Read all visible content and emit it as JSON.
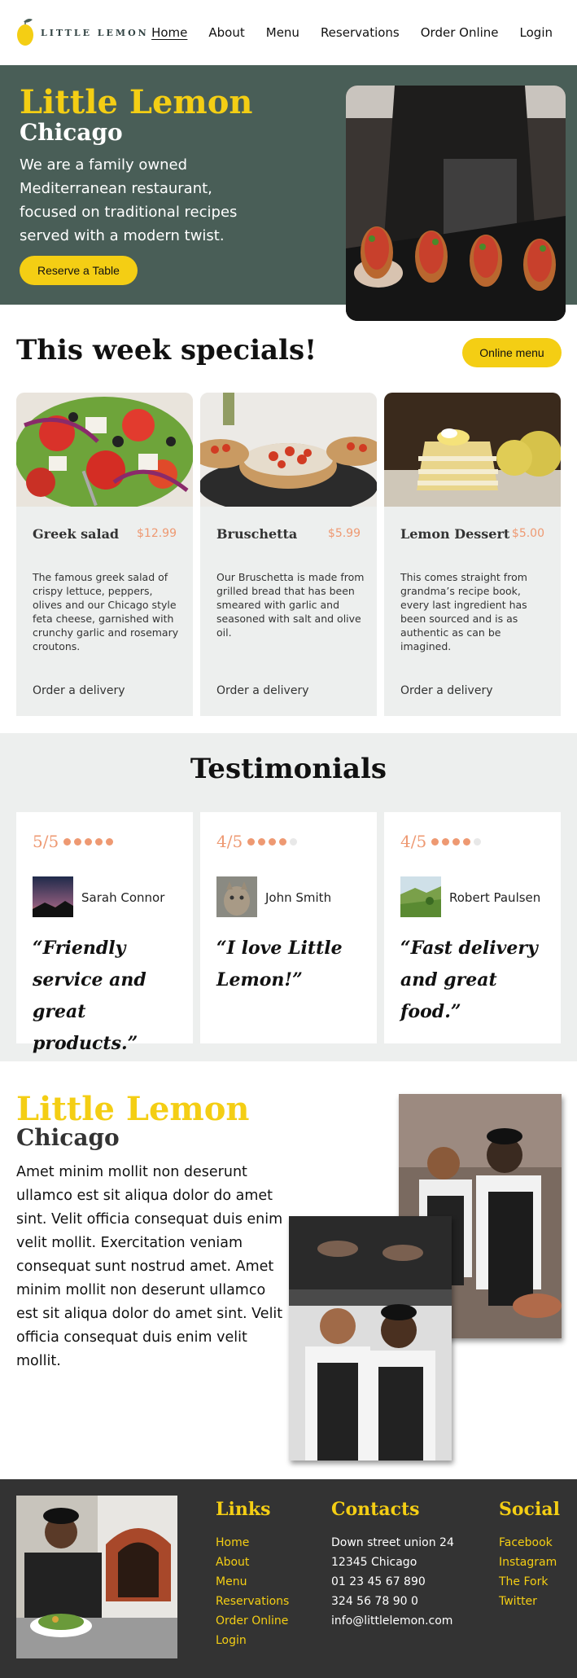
{
  "brand": {
    "name": "LITTLE LEMON"
  },
  "nav": [
    {
      "label": "Home"
    },
    {
      "label": "About"
    },
    {
      "label": "Menu"
    },
    {
      "label": "Reservations"
    },
    {
      "label": "Order Online"
    },
    {
      "label": "Login"
    }
  ],
  "hero": {
    "title": "Little Lemon",
    "subtitle": "Chicago",
    "description": "We are a family owned Mediterranean restaurant, focused on traditional recipes served with a modern twist.",
    "button": "Reserve a Table"
  },
  "specials": {
    "title": "This week specials!",
    "button": "Online menu",
    "items": [
      {
        "name": "Greek salad",
        "price": "$12.99",
        "description": "The famous greek salad of crispy lettuce, peppers, olives and our Chicago style feta cheese, garnished with crunchy garlic and rosemary croutons.",
        "action": "Order a delivery"
      },
      {
        "name": "Bruschetta",
        "price": "$5.99",
        "description": "Our Bruschetta is made from grilled bread that has been smeared with garlic and seasoned with salt and olive oil.",
        "action": "Order a delivery"
      },
      {
        "name": "Lemon Dessert",
        "price": "$5.00",
        "description": "This comes straight from grandma’s recipe book, every last ingredient has been sourced and is as authentic as can be imagined.",
        "action": "Order a delivery"
      }
    ]
  },
  "testimonials": {
    "title": "Testimonials",
    "items": [
      {
        "rating_text": "5/5",
        "stars": 5,
        "name": "Sarah Connor",
        "quote": "“Friendly service and great products.”"
      },
      {
        "rating_text": "4/5",
        "stars": 4,
        "name": "John Smith",
        "quote": "“I love Little Lemon!”"
      },
      {
        "rating_text": "4/5",
        "stars": 4,
        "name": "Robert Paulsen",
        "quote": "“Fast delivery and great food.”"
      }
    ]
  },
  "about": {
    "title": "Little Lemon",
    "subtitle": "Chicago",
    "text": "Amet minim mollit non deserunt ullamco est sit aliqua dolor do amet sint. Velit officia consequat duis enim velit mollit. Exercitation veniam consequat sunt nostrud amet. Amet minim mollit non deserunt ullamco est sit aliqua dolor do amet sint. Velit officia consequat duis enim velit mollit."
  },
  "footer": {
    "links": {
      "title": "Links",
      "items": [
        "Home",
        "About",
        "Menu",
        "Reservations",
        "Order Online",
        "Login"
      ]
    },
    "contacts": {
      "title": "Contacts",
      "items": [
        "Down street union 24",
        "12345 Chicago",
        "01 23 45 67 890",
        "324 56 78 90 0",
        "info@littlelemon.com"
      ]
    },
    "social": {
      "title": "Social",
      "items": [
        "Facebook",
        "Instagram",
        "The Fork",
        "Twitter"
      ]
    }
  },
  "colors": {
    "primary": "#495e57",
    "accent": "#f4ce14",
    "salmon": "#ee9972",
    "light": "#edefee",
    "dark": "#333333"
  }
}
